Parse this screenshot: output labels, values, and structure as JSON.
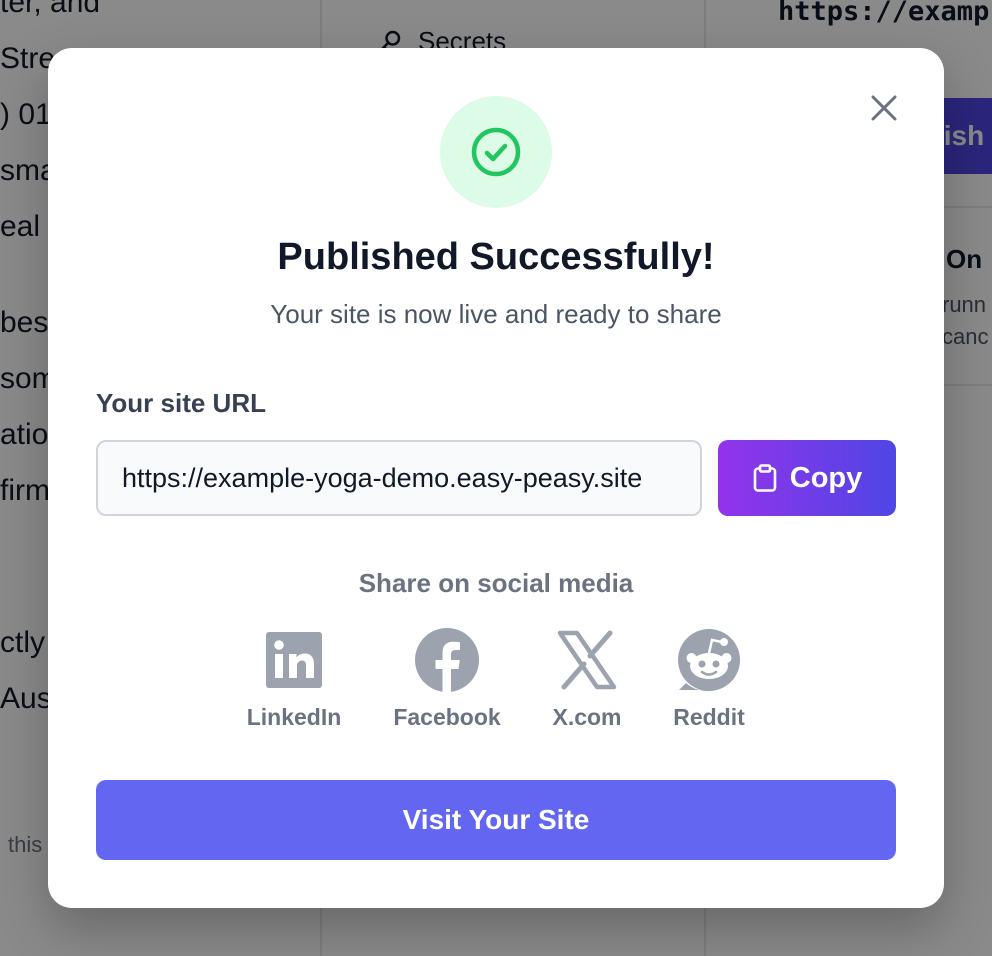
{
  "background": {
    "left_lines": [
      "ter, and",
      "Stre",
      ") 01",
      "sma",
      "eal",
      "bes",
      "som",
      "atio",
      "firm",
      "ctly",
      "Aus"
    ],
    "left_small": "this",
    "mid_item": "Secrets",
    "url_text": "https://examp",
    "publish_label": "lish",
    "right_title": "On",
    "right_lines": [
      "runn",
      "canc"
    ]
  },
  "modal": {
    "title": "Published Successfully!",
    "subtitle": "Your site is now live and ready to share",
    "url_label": "Your site URL",
    "url_value": "https://example-yoga-demo.easy-peasy.site",
    "copy_label": "Copy",
    "share_label": "Share on social media",
    "socials": [
      {
        "label": "LinkedIn",
        "icon": "linkedin-icon"
      },
      {
        "label": "Facebook",
        "icon": "facebook-icon"
      },
      {
        "label": "X.com",
        "icon": "x-icon"
      },
      {
        "label": "Reddit",
        "icon": "reddit-icon"
      }
    ],
    "visit_label": "Visit Your Site"
  },
  "colors": {
    "success_bg": "#dcfce7",
    "success_icon": "#22c55e",
    "copy_gradient_start": "#9333ea",
    "copy_gradient_end": "#4f46e5",
    "visit_button": "#6366f1",
    "social_icon": "#9ca3af"
  }
}
